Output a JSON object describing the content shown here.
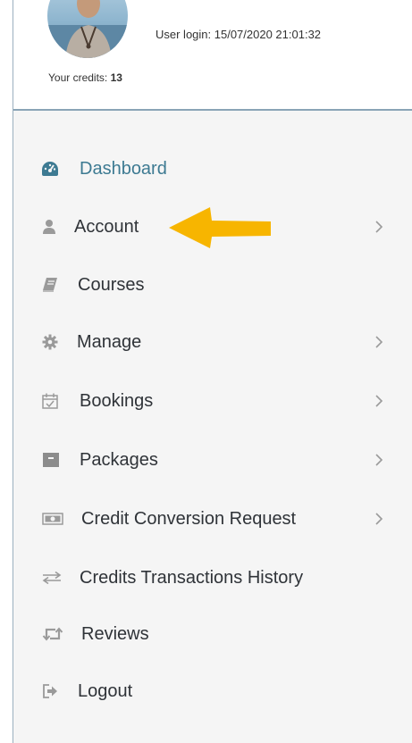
{
  "profile": {
    "login_text": "User login: 15/07/2020 21:01:32",
    "credits_label": "Your credits:",
    "credits_value": "13"
  },
  "menu": {
    "items": [
      {
        "label": "Dashboard",
        "icon": "dashboard-icon",
        "active": true,
        "has_chevron": false
      },
      {
        "label": "Account",
        "icon": "user-icon",
        "active": false,
        "has_chevron": true
      },
      {
        "label": "Courses",
        "icon": "book-icon",
        "active": false,
        "has_chevron": false
      },
      {
        "label": "Manage",
        "icon": "gear-icon",
        "active": false,
        "has_chevron": true
      },
      {
        "label": "Bookings",
        "icon": "calendar-check-icon",
        "active": false,
        "has_chevron": true
      },
      {
        "label": "Packages",
        "icon": "archive-icon",
        "active": false,
        "has_chevron": true
      },
      {
        "label": "Credit Conversion Request",
        "icon": "money-icon",
        "active": false,
        "has_chevron": true
      },
      {
        "label": "Credits Transactions History",
        "icon": "exchange-icon",
        "active": false,
        "has_chevron": false
      },
      {
        "label": "Reviews",
        "icon": "retweet-icon",
        "active": false,
        "has_chevron": false
      },
      {
        "label": "Logout",
        "icon": "sign-out-icon",
        "active": false,
        "has_chevron": false
      }
    ]
  },
  "colors": {
    "active": "#3d7a92",
    "text": "#2f3338",
    "menu_bg": "#f5f5f5",
    "arrow": "#f7b500",
    "icon": "#9a9a9a"
  }
}
